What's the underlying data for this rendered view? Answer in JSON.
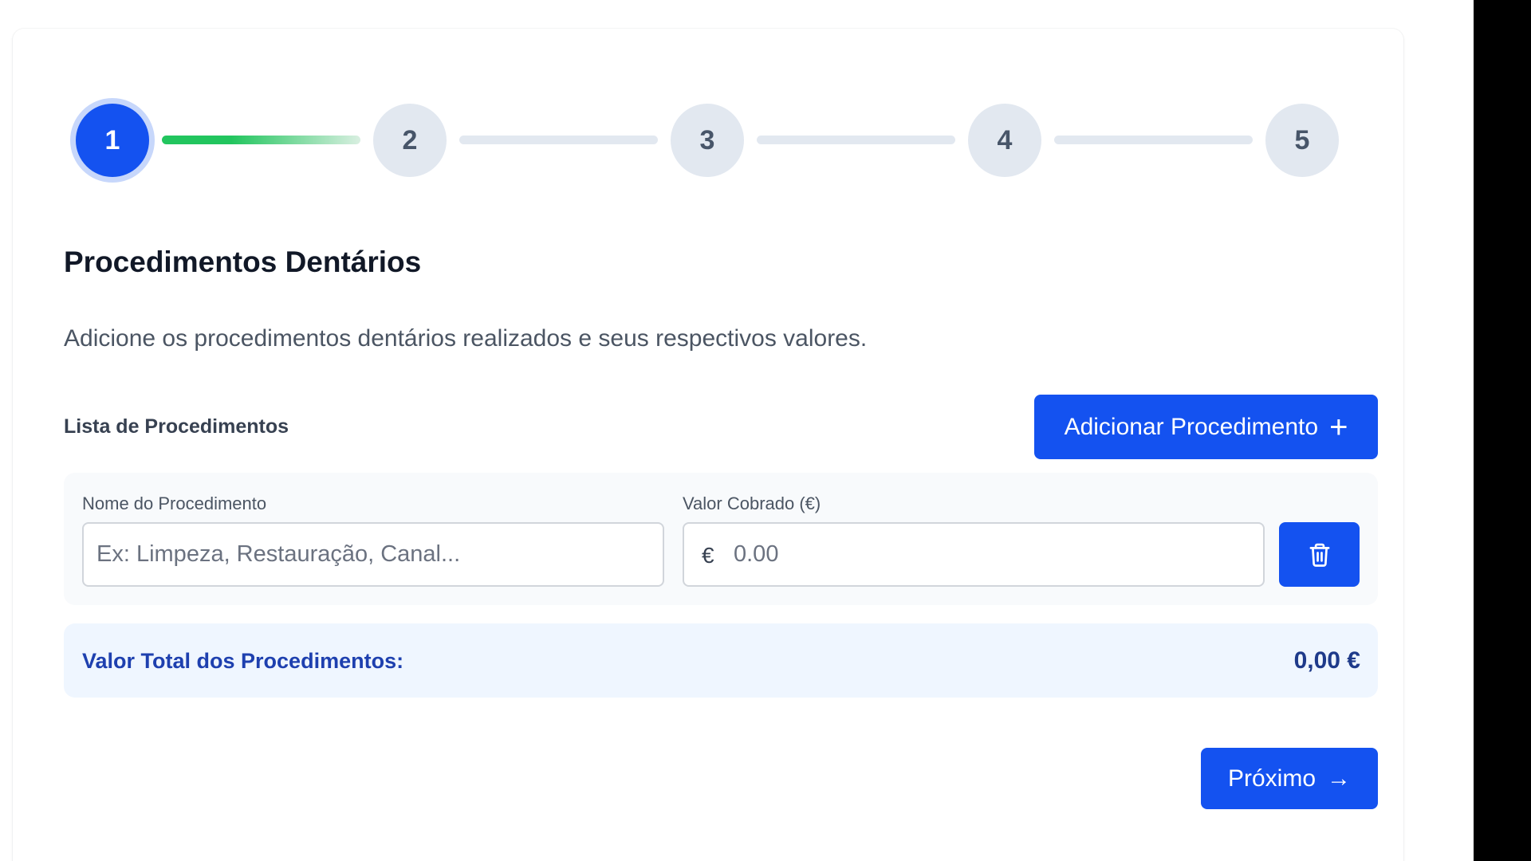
{
  "stepper": {
    "steps": [
      "1",
      "2",
      "3",
      "4",
      "5"
    ],
    "current_step": 1
  },
  "section": {
    "title": "Procedimentos Dentários",
    "description": "Adicione os procedimentos dentários realizados e seus respectivos valores."
  },
  "list": {
    "label": "Lista de Procedimentos",
    "add_button": "Adicionar Procedimento",
    "add_icon": "+"
  },
  "procedure": {
    "name_label": "Nome do Procedimento",
    "name_placeholder": "Ex: Limpeza, Restauração, Canal...",
    "name_value": "",
    "value_label": "Valor Cobrado (€)",
    "currency_symbol": "€",
    "value_placeholder": "0.00",
    "value_value": ""
  },
  "total": {
    "label": "Valor Total dos Procedimentos:",
    "value": "0,00 €"
  },
  "navigation": {
    "next_button": "Próximo",
    "next_icon": "→"
  },
  "icons": {
    "delete": "trash-icon",
    "add": "plus-icon",
    "next": "arrow-right-icon"
  },
  "colors": {
    "primary": "#1452f0",
    "progress": "#22c55e",
    "inactive_step": "#e2e8f0",
    "total_bg": "#eff6ff",
    "total_text": "#1e40af"
  }
}
